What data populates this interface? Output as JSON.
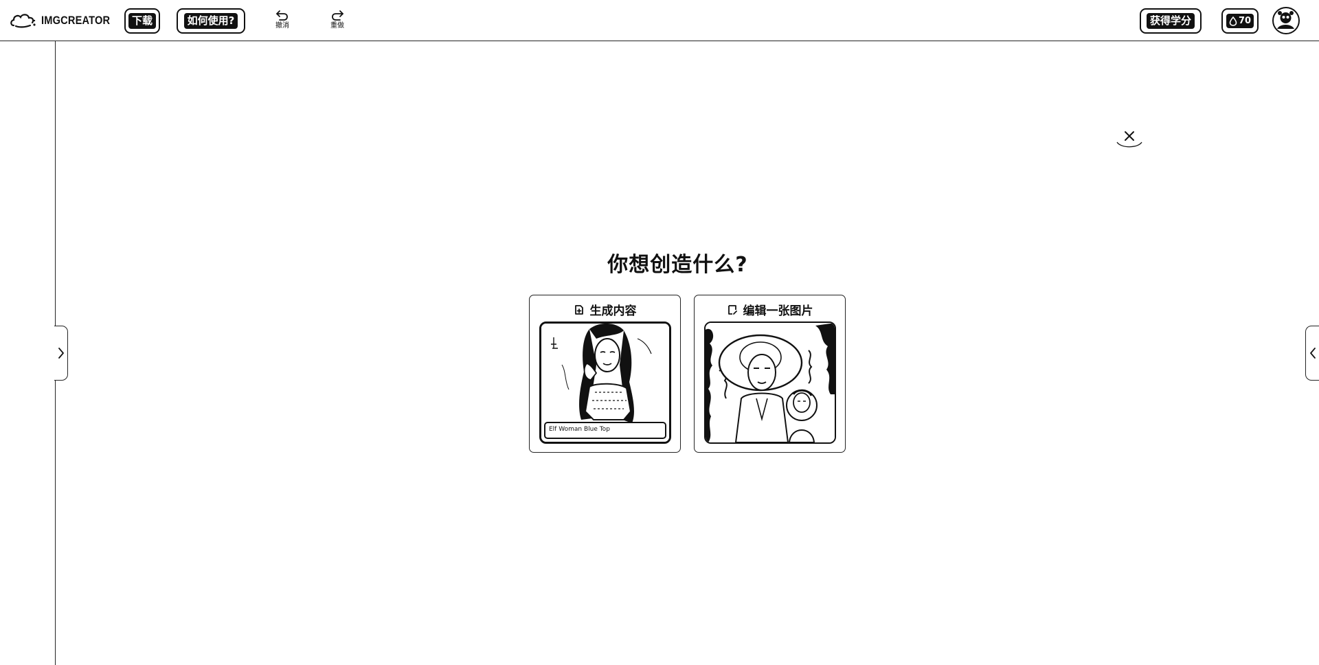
{
  "app": {
    "logo_text": "IMGCREATOR"
  },
  "toolbar": {
    "download_label": "下载",
    "howto_label": "如何使用?",
    "undo_label": "撤消",
    "redo_label": "重做",
    "credits_label": "获得学分",
    "points_value": "70"
  },
  "main": {
    "headline": "你想创造什么?",
    "cards": [
      {
        "title": "生成内容",
        "icon": "generate-icon",
        "prompt_text": "Elf Woman Blue Top"
      },
      {
        "title": "编辑一张图片",
        "icon": "edit-image-icon"
      }
    ]
  },
  "icons": {
    "logo": "cloud-logo-icon",
    "undo": "undo-icon",
    "redo": "redo-icon",
    "points": "drop-icon",
    "avatar": "user-avatar",
    "close": "close-icon",
    "expand_left": "chevron-right-icon",
    "expand_right": "chevron-left-icon"
  },
  "colors": {
    "foreground": "#111111",
    "background": "#ffffff"
  }
}
